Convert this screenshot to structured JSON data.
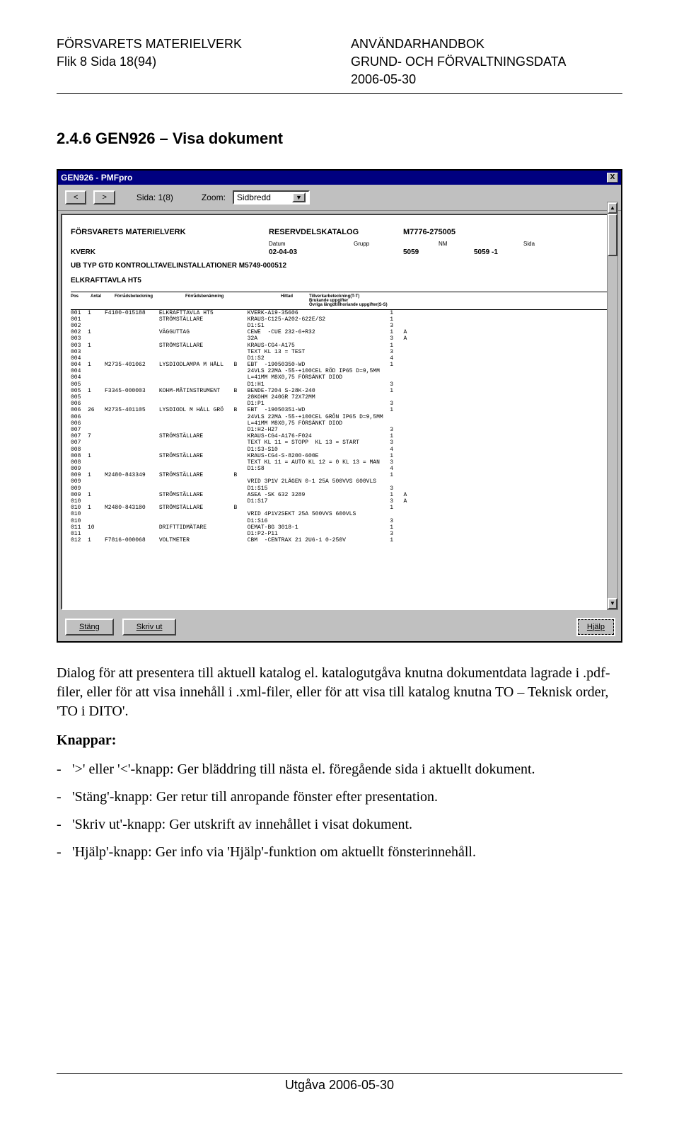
{
  "header": {
    "org": "FÖRSVARETS MATERIELVERK",
    "page_ref": "Flik 8  Sida 18(94)",
    "doc_title": "ANVÄNDARHANDBOK",
    "doc_sub": "GRUND- OCH FÖRVALTNINGSDATA",
    "date": "2006-05-30"
  },
  "section": {
    "number_title": "2.4.6  GEN926 – Visa dokument"
  },
  "window": {
    "title": "GEN926 - PMFpro",
    "close": "X",
    "nav_prev": "<",
    "nav_next": ">",
    "page_label": "Sida: 1(8)",
    "zoom_label": "Zoom:",
    "zoom_value": "Sidbredd",
    "bottom": {
      "close_btn": "Stäng",
      "print_btn": "Skriv ut",
      "help_btn": "Hjälp"
    }
  },
  "doc": {
    "hdr_org": "FÖRSVARETS MATERIELVERK",
    "hdr_type": "RESERVDELSKATALOG",
    "hdr_mnr": "M7776-275005",
    "sub_labels": {
      "datum": "Datum",
      "grupp": "Grupp",
      "nm": "NM",
      "sida": "Sida"
    },
    "kverk": "KVERK",
    "date": "02-04-03",
    "nm": "5059",
    "sida": "5059 -1",
    "line1": "UB TYP GTD  KONTROLLTAVELINSTALLATIONER  M5749-000512",
    "line2": "ELKRAFTTAVLA HT5",
    "thead": {
      "pos": "Pos",
      "antal": "Antal",
      "fnr": "Förrådsbeteckning",
      "ben": "Förrådsbenämning",
      "h": "Hittad",
      "tillv": "Tillverkarbeteckning(T-T)\nBrukande uppgifter\nÖvriga längdtillhoriande uppgifter(S-S)",
      "k": ""
    },
    "rows": [
      {
        "pos": "001",
        "a": "1",
        "fnr": "F4100-015188",
        "ben": "ELKRAFTTAVLA HT5",
        "h": "",
        "t": "KVERK-A19-35606",
        "k": "1"
      },
      {
        "pos": "001",
        "a": "",
        "fnr": "",
        "ben": "STRÖMSTÄLLARE",
        "h": "",
        "t": "KRAUS-C125-A202-622E/S2",
        "k": "1"
      },
      {
        "pos": "002",
        "a": "",
        "fnr": "",
        "ben": "",
        "h": "",
        "t": "D1:S1",
        "k": "3"
      },
      {
        "pos": "002",
        "a": "1",
        "fnr": "",
        "ben": "VÄGGUTTAG",
        "h": "",
        "t": "CEWE  -CUE 232-6+R32",
        "k": "1   A"
      },
      {
        "pos": "003",
        "a": "",
        "fnr": "",
        "ben": "",
        "h": "",
        "t": "32A",
        "k": "3   A"
      },
      {
        "pos": "003",
        "a": "1",
        "fnr": "",
        "ben": "STRÖMSTÄLLARE",
        "h": "",
        "t": "KRAUS-CG4-A175",
        "k": "1"
      },
      {
        "pos": "003",
        "a": "",
        "fnr": "",
        "ben": "",
        "h": "",
        "t": "TEXT KL 13 = TEST",
        "k": "3"
      },
      {
        "pos": "004",
        "a": "",
        "fnr": "",
        "ben": "",
        "h": "",
        "t": "D1:S2",
        "k": "4"
      },
      {
        "pos": "004",
        "a": "1",
        "fnr": "M2735-401062",
        "ben": "LYSDIODLAMPA M HÅLL",
        "h": "B",
        "t": "EBT  -19050350-WD",
        "k": "1"
      },
      {
        "pos": "004",
        "a": "",
        "fnr": "",
        "ben": "",
        "h": "",
        "t": "24VLS 22MA -55-+100CEL RÖD IP65 D=9,5MM",
        "k": ""
      },
      {
        "pos": "004",
        "a": "",
        "fnr": "",
        "ben": "",
        "h": "",
        "t": "L=41MM M8X0,75 FÖRSÄNKT DIOD",
        "k": ""
      },
      {
        "pos": "005",
        "a": "",
        "fnr": "",
        "ben": "",
        "h": "",
        "t": "D1:H1",
        "k": "3"
      },
      {
        "pos": "005",
        "a": "1",
        "fnr": "F3345-000003",
        "ben": "KOHM-MÄTINSTRUMENT",
        "h": "B",
        "t": "BENDE-7204 S-28K-240",
        "k": "1"
      },
      {
        "pos": "005",
        "a": "",
        "fnr": "",
        "ben": "",
        "h": "",
        "t": "28KOHM 240GR 72X72MM",
        "k": ""
      },
      {
        "pos": "006",
        "a": "",
        "fnr": "",
        "ben": "",
        "h": "",
        "t": "D1:P1",
        "k": "3"
      },
      {
        "pos": "006",
        "a": "26",
        "fnr": "M2735-401105",
        "ben": "LYSDIODL M HÅLL GRÖ",
        "h": "B",
        "t": "EBT  -19050351-WD",
        "k": "1"
      },
      {
        "pos": "006",
        "a": "",
        "fnr": "",
        "ben": "",
        "h": "",
        "t": "24VLS 22MA -55-+100CEL GRÖN IP65 D=9,5MM",
        "k": ""
      },
      {
        "pos": "006",
        "a": "",
        "fnr": "",
        "ben": "",
        "h": "",
        "t": "L=41MM M8X0,75 FÖRSÄNKT DIOD",
        "k": ""
      },
      {
        "pos": "007",
        "a": "",
        "fnr": "",
        "ben": "",
        "h": "",
        "t": "D1:H2-H27",
        "k": "3"
      },
      {
        "pos": "007",
        "a": "7",
        "fnr": "",
        "ben": "STRÖMSTÄLLARE",
        "h": "",
        "t": "KRAUS-CG4-A176-F024",
        "k": "1"
      },
      {
        "pos": "007",
        "a": "",
        "fnr": "",
        "ben": "",
        "h": "",
        "t": "TEXT KL 11 = STOPP  KL 13 = START",
        "k": "3"
      },
      {
        "pos": "008",
        "a": "",
        "fnr": "",
        "ben": "",
        "h": "",
        "t": "D1:S3-S10",
        "k": "4"
      },
      {
        "pos": "008",
        "a": "1",
        "fnr": "",
        "ben": "STRÖMSTÄLLARE",
        "h": "",
        "t": "KRAUS-CG4-S-8200-600E",
        "k": "1"
      },
      {
        "pos": "008",
        "a": "",
        "fnr": "",
        "ben": "",
        "h": "",
        "t": "TEXT KL 11 = AUTO KL 12 = 0 KL 13 = MAN",
        "k": "3"
      },
      {
        "pos": "009",
        "a": "",
        "fnr": "",
        "ben": "",
        "h": "",
        "t": "D1:S8",
        "k": "4"
      },
      {
        "pos": "009",
        "a": "1",
        "fnr": "M2480-843349",
        "ben": "STRÖMSTÄLLARE",
        "h": "B",
        "t": "",
        "k": "1"
      },
      {
        "pos": "009",
        "a": "",
        "fnr": "",
        "ben": "",
        "h": "",
        "t": "VRID 3P1V 2LÄGEN 0-1 25A 500VVS 600VLS",
        "k": ""
      },
      {
        "pos": "009",
        "a": "",
        "fnr": "",
        "ben": "",
        "h": "",
        "t": "D1:S15",
        "k": "3"
      },
      {
        "pos": "009",
        "a": "1",
        "fnr": "",
        "ben": "STRÖMSTÄLLARE",
        "h": "",
        "t": "ASEA -SK 632 3289",
        "k": "1   A"
      },
      {
        "pos": "010",
        "a": "",
        "fnr": "",
        "ben": "",
        "h": "",
        "t": "D1:S17",
        "k": "3   A"
      },
      {
        "pos": "010",
        "a": "1",
        "fnr": "M2480-843180",
        "ben": "STRÖMSTÄLLARE",
        "h": "B",
        "t": "",
        "k": "1"
      },
      {
        "pos": "010",
        "a": "",
        "fnr": "",
        "ben": "",
        "h": "",
        "t": "VRID 4P1V2SEKT 25A 500VVS 600VLS",
        "k": ""
      },
      {
        "pos": "010",
        "a": "",
        "fnr": "",
        "ben": "",
        "h": "",
        "t": "D1:S16",
        "k": "3"
      },
      {
        "pos": "011",
        "a": "10",
        "fnr": "",
        "ben": "DRIFTTIDMÄTARE",
        "h": "",
        "t": "OEMAT-BG 3018-1",
        "k": "1"
      },
      {
        "pos": "011",
        "a": "",
        "fnr": "",
        "ben": "",
        "h": "",
        "t": "D1:P2-P11",
        "k": "3"
      },
      {
        "pos": "012",
        "a": "1",
        "fnr": "F7816-000068",
        "ben": "VOLTMETER",
        "h": "",
        "t": "CBM  -CENTRAX 21 2U6-1 0-250V",
        "k": "1"
      }
    ]
  },
  "body": {
    "p1": "Dialog för att presentera till aktuell katalog el. katalogutgåva knutna dokumentdata lagrade i .pdf-filer, eller för att visa innehåll i .xml-filer, eller för att visa till katalog knutna TO – Teknisk order, 'TO i DITO'.",
    "knappar": "Knappar:",
    "b1": "'>' eller '<'-knapp:  Ger bläddring till nästa el. föregående sida i aktuellt dokument.",
    "b2": "'Stäng'-knapp:  Ger retur till anropande fönster efter presentation.",
    "b3": "'Skriv ut'-knapp:  Ger utskrift av innehållet i visat dokument.",
    "b4": "'Hjälp'-knapp:  Ger info via 'Hjälp'-funktion om aktuellt fönsterinnehåll."
  },
  "footer": "Utgåva 2006-05-30"
}
